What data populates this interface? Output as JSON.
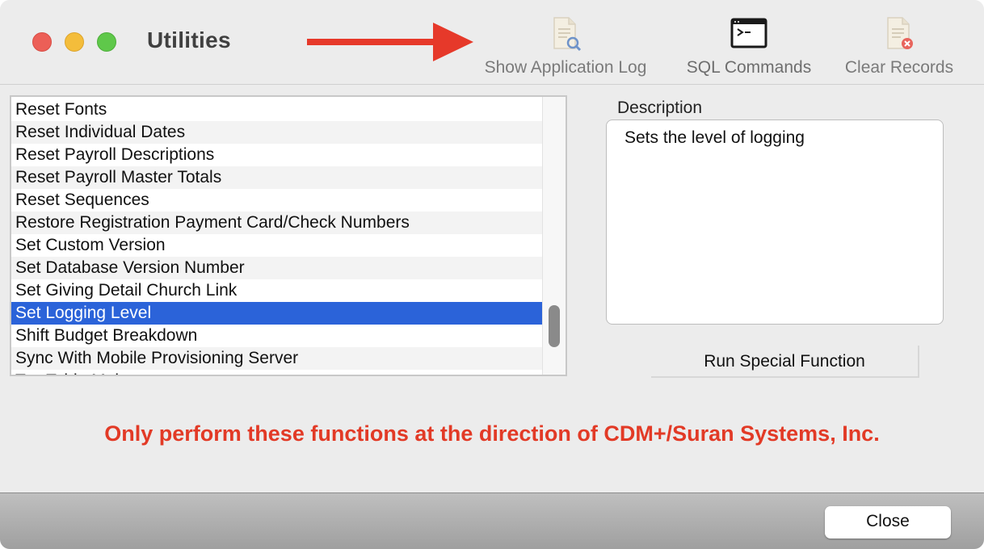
{
  "window": {
    "title": "Utilities"
  },
  "toolbar": {
    "items": [
      {
        "label": "Show Application Log",
        "icon": "document-search-icon"
      },
      {
        "label": "SQL Commands",
        "icon": "terminal-icon"
      },
      {
        "label": "Clear Records",
        "icon": "document-delete-icon"
      }
    ]
  },
  "functions": {
    "items": [
      "Reset Fonts",
      "Reset Individual Dates",
      "Reset Payroll Descriptions",
      "Reset Payroll Master Totals",
      "Reset Sequences",
      "Restore Registration Payment Card/Check Numbers",
      "Set Custom Version",
      "Set Database Version Number",
      "Set Giving Detail Church Link",
      "Set Logging Level",
      "Shift Budget Breakdown",
      "Sync With Mobile Provisioning Server",
      "Tax Table Maint..."
    ],
    "selected": "Set Logging Level"
  },
  "description": {
    "label": "Description",
    "text": "Sets the level of logging"
  },
  "actions": {
    "run_label": "Run Special Function",
    "close_label": "Close"
  },
  "warning": {
    "text": "Only perform these functions at the direction of CDM+/Suran Systems, Inc."
  },
  "colors": {
    "selection": "#2b63d9",
    "warning": "#e23a26",
    "arrow": "#e6392a"
  }
}
